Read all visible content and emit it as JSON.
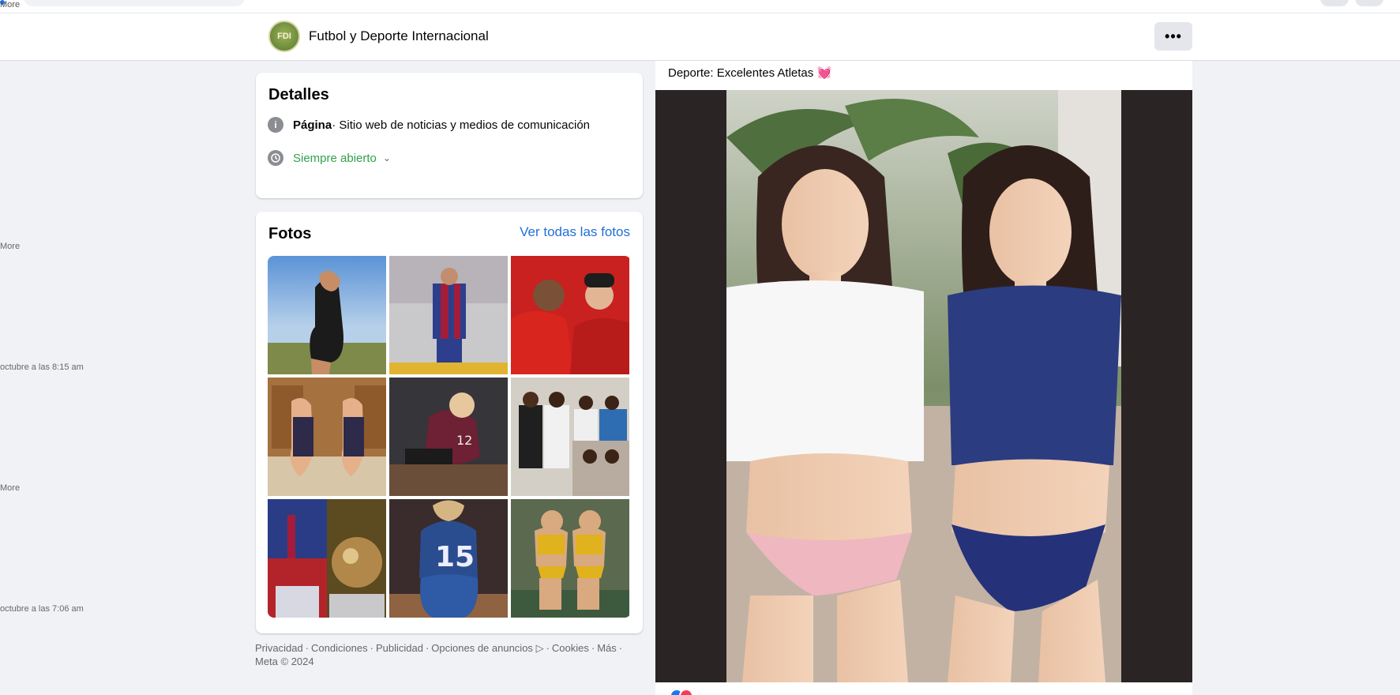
{
  "top": {
    "more_label": "More"
  },
  "page": {
    "avatar_text": "FDI",
    "name": "Futbol y Deporte Internacional",
    "menu_label": "•••"
  },
  "left_column": {
    "snippets": [
      "More",
      "octubre a las 8:15 am",
      "More",
      "octubre a las 7:06 am"
    ]
  },
  "details": {
    "title": "Detalles",
    "info_icon": "info-icon",
    "category_bold": "Página",
    "category_rest": " · Sitio web de noticias y medios de comunicación",
    "clock_icon": "clock-icon",
    "hours": "Siempre abierto"
  },
  "photos": {
    "title": "Fotos",
    "see_all": "Ver todas las fotos",
    "items": [
      {
        "desc": "woman-sky"
      },
      {
        "desc": "player-barca"
      },
      {
        "desc": "red-tracksuits"
      },
      {
        "desc": "gymnasts"
      },
      {
        "desc": "volleyball-maroon"
      },
      {
        "desc": "group-photo"
      },
      {
        "desc": "collage-ballon"
      },
      {
        "desc": "volleyball-15"
      },
      {
        "desc": "beach-volley"
      }
    ]
  },
  "footer": {
    "links": [
      "Privacidad",
      "Condiciones",
      "Publicidad",
      "Opciones de anuncios",
      "Cookies",
      "Más"
    ],
    "copyright": "Meta © 2024"
  },
  "post": {
    "caption": "Deporte: Excelentes Atletas 💓"
  },
  "colors": {
    "link": "#216fdb",
    "green": "#31a24c",
    "bg": "#f0f2f5"
  }
}
